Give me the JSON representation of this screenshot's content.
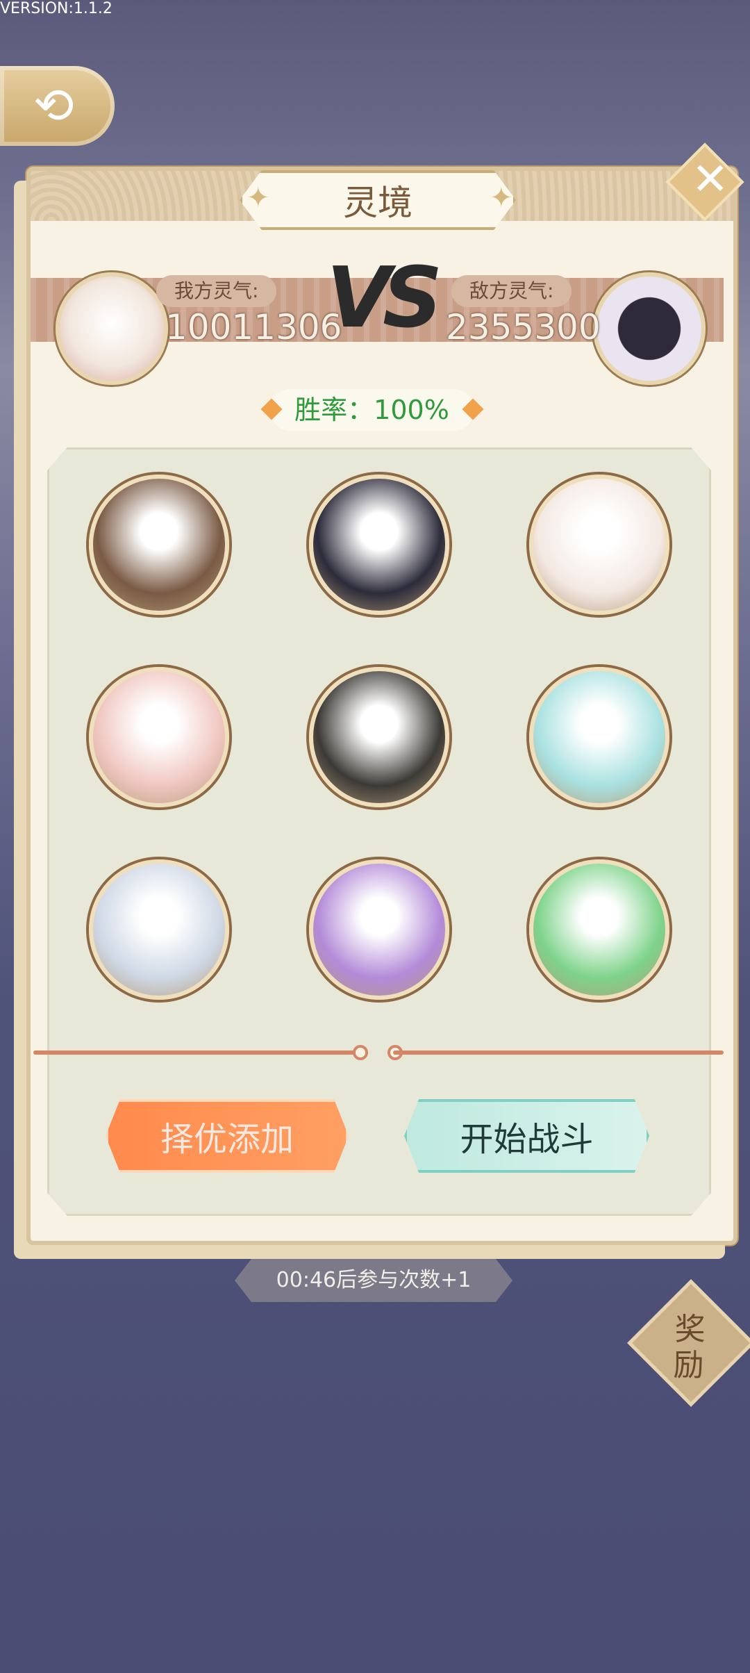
{
  "version": "VERSION:1.1.2",
  "title": "灵境",
  "my_aura_label": "我方灵气:",
  "my_aura_value": "10011306",
  "enemy_aura_label": "敌方灵气:",
  "enemy_aura_value": "2355300",
  "vs_text": "VS",
  "win_rate_text": "胜率：100%",
  "buttons": {
    "auto_add": "择优添加",
    "start_battle": "开始战斗"
  },
  "timer_text": "00:46后参与次数+1",
  "reward": [
    "奖",
    "励"
  ],
  "heroes": [
    {
      "id": "hero-1",
      "color": "#7a5a44"
    },
    {
      "id": "hero-2",
      "color": "#2c2b3a"
    },
    {
      "id": "hero-3",
      "color": "#f3e8e2"
    },
    {
      "id": "hero-4",
      "color": "#f0c6c0"
    },
    {
      "id": "hero-5",
      "color": "#3c3a36"
    },
    {
      "id": "hero-6",
      "color": "#a9e1e0"
    },
    {
      "id": "hero-7",
      "color": "#cfd8e5"
    },
    {
      "id": "hero-8",
      "color": "#b38ad8"
    },
    {
      "id": "hero-9",
      "color": "#7ed38b"
    }
  ]
}
